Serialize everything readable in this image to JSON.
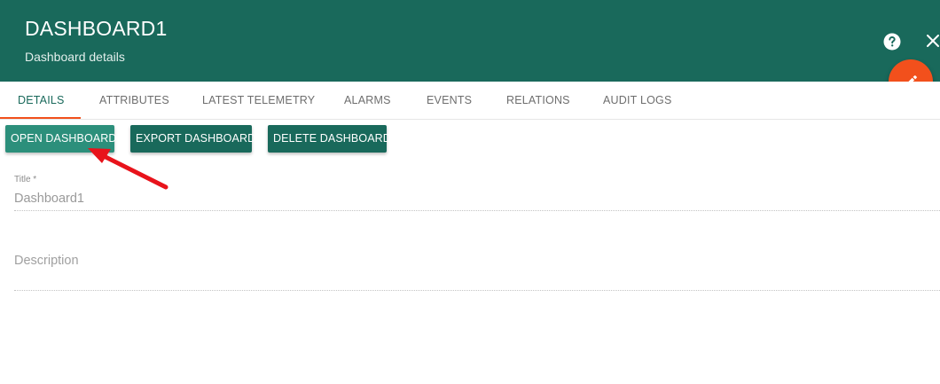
{
  "header": {
    "title": "DASHBOARD1",
    "subtitle": "Dashboard details",
    "help_icon": "help-circle-icon",
    "close_icon": "close-icon",
    "bg_color": "#19695b"
  },
  "fab": {
    "icon": "pencil-icon",
    "color": "#f2501c"
  },
  "tabs": [
    {
      "label": "DETAILS",
      "active": true
    },
    {
      "label": "ATTRIBUTES"
    },
    {
      "label": "LATEST TELEMETRY"
    },
    {
      "label": "ALARMS"
    },
    {
      "label": "EVENTS"
    },
    {
      "label": "RELATIONS"
    },
    {
      "label": "AUDIT LOGS"
    }
  ],
  "actions": {
    "open_label": "OPEN DASHBOARD",
    "export_label": "EXPORT DASHBOARD",
    "delete_label": "DELETE DASHBOARD"
  },
  "form": {
    "title_label": "Title *",
    "title_value": "Dashboard1",
    "description_placeholder": "Description",
    "description_value": ""
  },
  "annotation": {
    "color": "#e8131b"
  }
}
